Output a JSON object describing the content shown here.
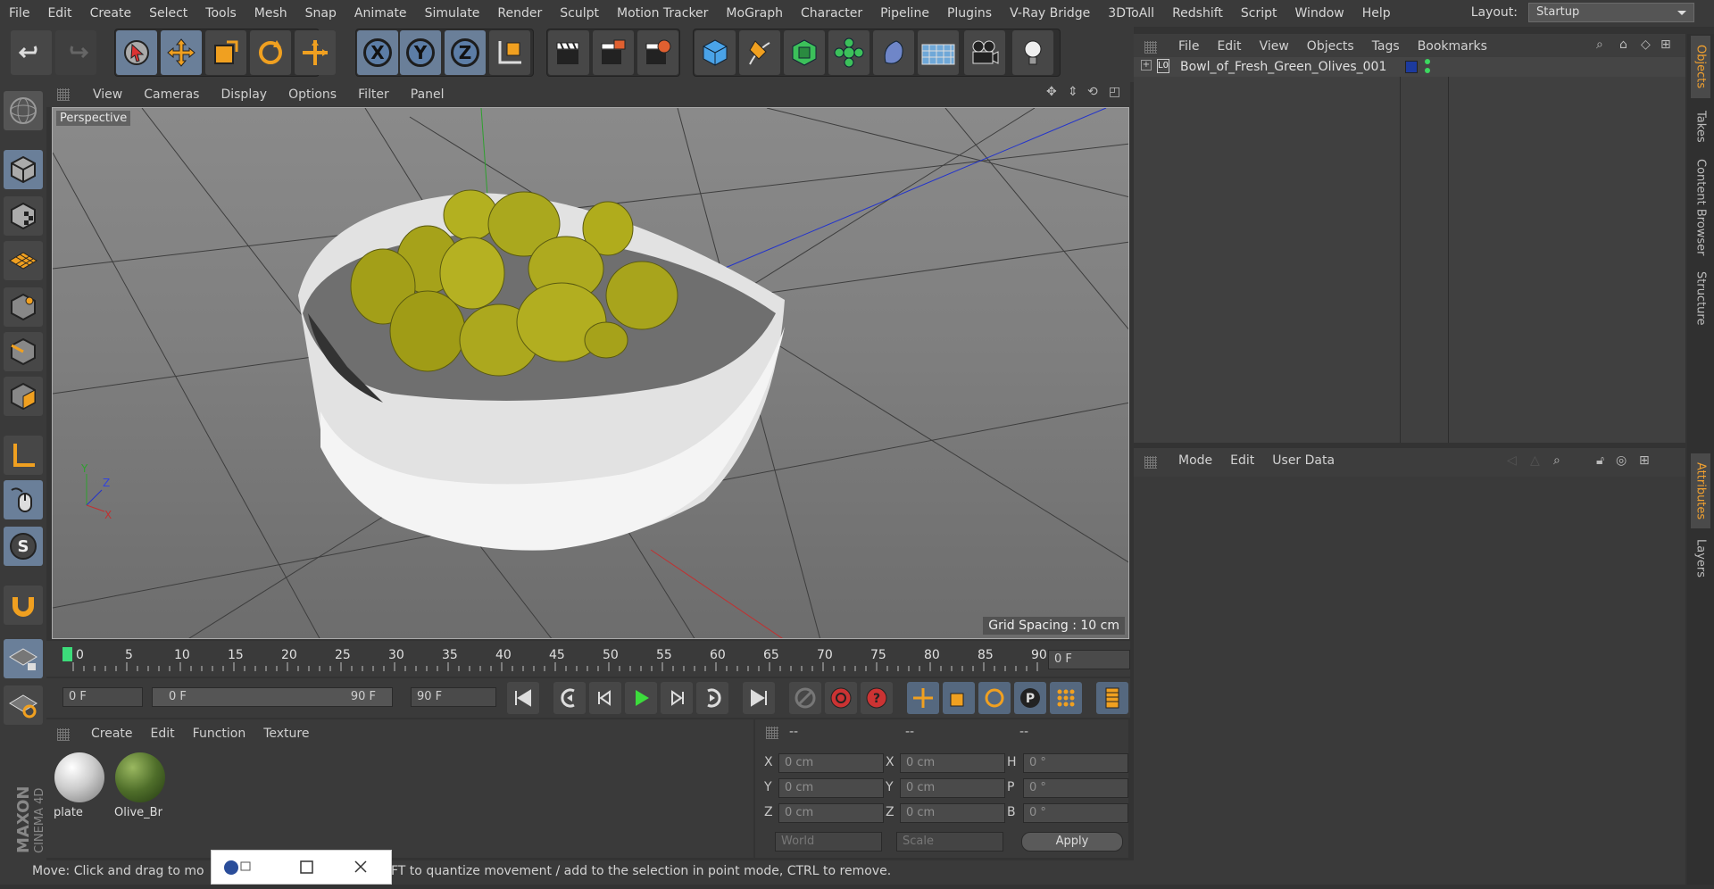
{
  "menubar": {
    "items": [
      "File",
      "Edit",
      "Create",
      "Select",
      "Tools",
      "Mesh",
      "Snap",
      "Animate",
      "Simulate",
      "Render",
      "Sculpt",
      "Motion Tracker",
      "MoGraph",
      "Character",
      "Pipeline",
      "Plugins",
      "V-Ray Bridge",
      "3DToAll",
      "Redshift",
      "Script",
      "Window",
      "Help"
    ],
    "layout_label": "Layout:",
    "layout_value": "Startup"
  },
  "toolbar": {
    "axis_x": "X",
    "axis_y": "Y",
    "axis_z": "Z"
  },
  "viewport": {
    "menu": [
      "View",
      "Cameras",
      "Display",
      "Options",
      "Filter",
      "Panel"
    ],
    "view_label": "Perspective",
    "grid_spacing": "Grid Spacing : 10 cm",
    "axis_y": "Y",
    "axis_z": "Z",
    "axis_x": "X"
  },
  "timeline": {
    "ticks": [
      "0",
      "5",
      "10",
      "15",
      "20",
      "25",
      "30",
      "35",
      "40",
      "45",
      "50",
      "55",
      "60",
      "65",
      "70",
      "75",
      "80",
      "85",
      "90"
    ],
    "current_frame": "0 F"
  },
  "transport": {
    "start": "0 F",
    "range_start": "0 F",
    "range_end": "90 F",
    "end": "90 F"
  },
  "materials": {
    "menu": [
      "Create",
      "Edit",
      "Function",
      "Texture"
    ],
    "items": [
      {
        "name": "plate"
      },
      {
        "name": "Olive_Br"
      }
    ]
  },
  "coordinates": {
    "header": [
      "--",
      "--",
      "--"
    ],
    "pos": [
      {
        "label": "X",
        "value": "0 cm"
      },
      {
        "label": "Y",
        "value": "0 cm"
      },
      {
        "label": "Z",
        "value": "0 cm"
      }
    ],
    "size": [
      {
        "label": "X",
        "value": "0 cm"
      },
      {
        "label": "Y",
        "value": "0 cm"
      },
      {
        "label": "Z",
        "value": "0 cm"
      }
    ],
    "rot": [
      {
        "label": "H",
        "value": "0 °"
      },
      {
        "label": "P",
        "value": "0 °"
      },
      {
        "label": "B",
        "value": "0 °"
      }
    ],
    "world": "World",
    "scale": "Scale",
    "apply": "Apply"
  },
  "status": {
    "text": "Move: Click and drag to mo",
    "text2": "FT to quantize movement / add to the selection in point mode, CTRL to remove."
  },
  "objects": {
    "menu": [
      "File",
      "Edit",
      "View",
      "Objects",
      "Tags",
      "Bookmarks"
    ],
    "object_name": "Bowl_of_Fresh_Green_Olives_001",
    "layer_icon": "L0"
  },
  "attributes": {
    "menu": [
      "Mode",
      "Edit",
      "User Data"
    ]
  },
  "right_tabs": [
    "Objects",
    "Takes",
    "Content Browser",
    "Structure",
    "Attributes",
    "Layers"
  ],
  "brand": {
    "line1": "MAXON",
    "line2": "CINEMA 4D"
  }
}
